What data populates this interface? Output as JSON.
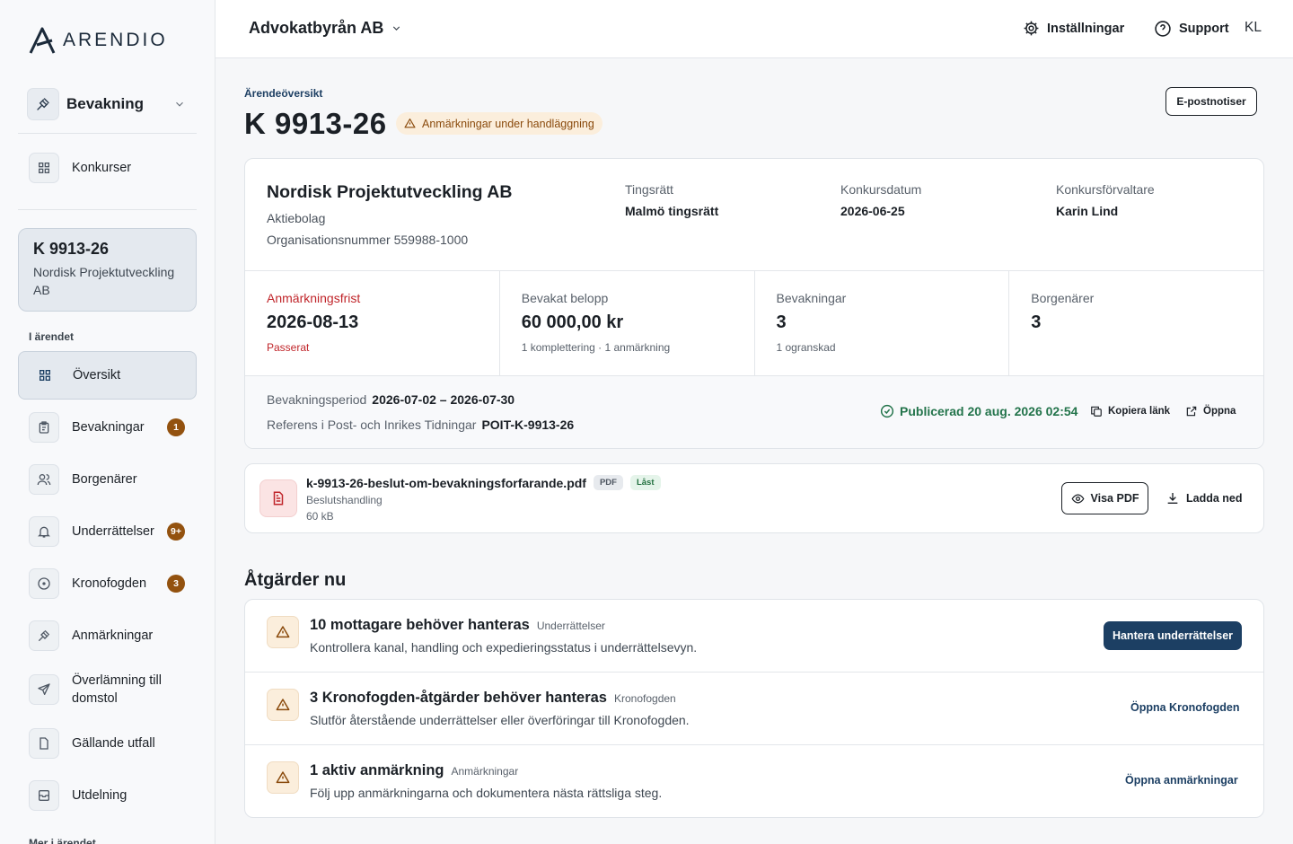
{
  "brand": {
    "name": "ARENDIO"
  },
  "sidebar": {
    "module": "Bevakning",
    "top_item": "Konkurser",
    "case": {
      "id": "K 9913-26",
      "name": "Nordisk Projektutveckling AB"
    },
    "section_title": "I ärendet",
    "items": [
      {
        "label": "Översikt",
        "icon": "grid-icon"
      },
      {
        "label": "Bevakningar",
        "badge": "1",
        "icon": "clipboard-icon"
      },
      {
        "label": "Borgenärer",
        "icon": "users-icon"
      },
      {
        "label": "Underrättelser",
        "badge": "9+",
        "icon": "bell-icon"
      },
      {
        "label": "Kronofogden",
        "badge": "3",
        "icon": "circle-dot-icon"
      },
      {
        "label": "Anmärkningar",
        "icon": "gavel-icon"
      },
      {
        "label": "Överlämning till domstol",
        "icon": "send-icon"
      },
      {
        "label": "Gällande utfall",
        "icon": "document-icon"
      },
      {
        "label": "Utdelning",
        "icon": "inbox-icon"
      }
    ],
    "more_title": "Mer i ärendet"
  },
  "topbar": {
    "org": "Advokatbyrån AB",
    "settings": "Inställningar",
    "support": "Support",
    "initials": "KL"
  },
  "page": {
    "breadcrumb": "Ärendeöversikt",
    "title": "K 9913-26",
    "status": "Anmärkningar under handläggning",
    "epost": "E-postnotiser"
  },
  "summary": {
    "company": "Nordisk Projektutveckling AB",
    "company_type": "Aktiebolag",
    "org_number": "Organisationsnummer 559988-1000",
    "fields": [
      {
        "label": "Tingsrätt",
        "value": "Malmö tingsrätt"
      },
      {
        "label": "Konkursdatum",
        "value": "2026-06-25"
      },
      {
        "label": "Konkursförvaltare",
        "value": "Karin Lind"
      }
    ],
    "stats": [
      {
        "label": "Anmärkningsfrist",
        "value": "2026-08-13",
        "sub": "Passerat",
        "alert": true
      },
      {
        "label": "Bevakat belopp",
        "value": "60 000,00 kr",
        "sub": "1 komplettering · 1 anmärkning"
      },
      {
        "label": "Bevakningar",
        "value": "3",
        "sub": "1 ogranskad"
      },
      {
        "label": "Borgenärer",
        "value": "3",
        "sub": ""
      }
    ],
    "period_label": "Bevakningsperiod",
    "period_value": "2026-07-02 – 2026-07-30",
    "ref_label": "Referens i Post- och Inrikes Tidningar",
    "ref_value": "POIT-K-9913-26",
    "published": "Publicerad 20 aug. 2026 02:54",
    "copy_link": "Kopiera länk",
    "open": "Öppna"
  },
  "document": {
    "filename": "k-9913-26-beslut-om-bevakningsforfarande.pdf",
    "tag_type": "PDF",
    "tag_status": "Låst",
    "kind": "Beslutshandling",
    "size": "60 kB",
    "view": "Visa PDF",
    "download": "Ladda ned"
  },
  "actions_title": "Åtgärder nu",
  "actions": [
    {
      "title": "10 mottagare behöver hanteras",
      "category": "Underrättelser",
      "desc": "Kontrollera kanal, handling och expedieringsstatus i underrättelsevyn.",
      "button": "Hantera underrättelser",
      "primary": true
    },
    {
      "title": "3 Kronofogden-åtgärder behöver hanteras",
      "category": "Kronofogden",
      "desc": "Slutför återstående underrättelser eller överföringar till Kronofogden.",
      "button": "Öppna Kronofogden",
      "primary": false
    },
    {
      "title": "1 aktiv anmärkning",
      "category": "Anmärkningar",
      "desc": "Följ upp anmärkningarna och dokumentera nästa rättsliga steg.",
      "button": "Öppna anmärkningar",
      "primary": false
    }
  ],
  "colors": {
    "primary": "#1c3f63",
    "warning": "#93520f",
    "alert": "#c0252a",
    "success": "#23744b"
  }
}
